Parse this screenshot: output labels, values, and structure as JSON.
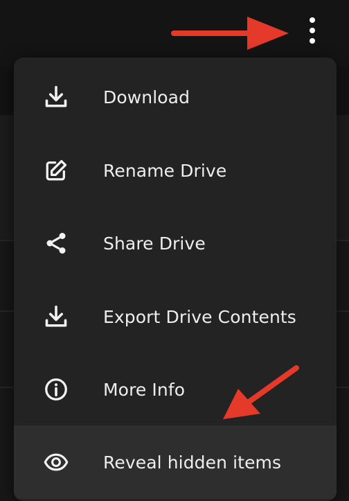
{
  "menu": {
    "items": [
      {
        "label": "Download",
        "icon": "download-icon"
      },
      {
        "label": "Rename Drive",
        "icon": "edit-icon"
      },
      {
        "label": "Share Drive",
        "icon": "share-icon"
      },
      {
        "label": "Export Drive Contents",
        "icon": "download-icon"
      },
      {
        "label": "More Info",
        "icon": "info-icon"
      },
      {
        "label": "Reveal hidden items",
        "icon": "eye-icon"
      }
    ],
    "highlighted_item": "Reveal hidden items"
  },
  "toolbar": {
    "more_options_icon": "kebab-vertical-icon"
  },
  "annotations": {
    "arrow_color": "#e5392a"
  },
  "colors": {
    "menu_background": "#232323",
    "highlight_background": "#2e2e2e",
    "text": "#eeeeee"
  }
}
